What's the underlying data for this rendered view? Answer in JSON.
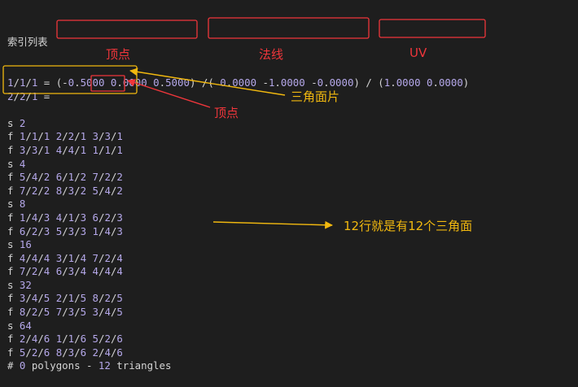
{
  "editor": {
    "heading": "索引列表",
    "lines": [
      "1/1/1 = (-0.5000 0.0000 0.5000) /( 0.0000 -1.0000 -0.0000) / (1.0000 0.0000)",
      "2/2/1 =",
      "",
      "s 2",
      "f 1/1/1 2/2/1 3/3/1",
      "f 3/3/1 4/4/1 1/1/1",
      "s 4",
      "f 5/4/2 6/1/2 7/2/2",
      "f 7/2/2 8/3/2 5/4/2",
      "s 8",
      "f 1/4/3 4/1/3 6/2/3",
      "f 6/2/3 5/3/3 1/4/3",
      "s 16",
      "f 4/4/4 3/1/4 7/2/4",
      "f 7/2/4 6/3/4 4/4/4",
      "s 32",
      "f 3/4/5 2/1/5 8/2/5",
      "f 8/2/5 7/3/5 3/4/5",
      "s 64",
      "f 2/4/6 1/1/6 5/2/6",
      "f 5/2/6 8/3/6 2/4/6",
      "# 0 polygons - 12 triangles"
    ]
  },
  "annotations": {
    "vertex_top": "顶点",
    "normal": "法线",
    "uv": "UV",
    "triangle_patch": "三角面片",
    "vertex_mid": "顶点",
    "row_note": "12行就是有12个三角面"
  },
  "colors": {
    "background": "#1e1e1e",
    "number": "#b5a8ea",
    "text": "#d4d4d4",
    "red": "#f0363b",
    "yellow": "#f1b80f"
  }
}
